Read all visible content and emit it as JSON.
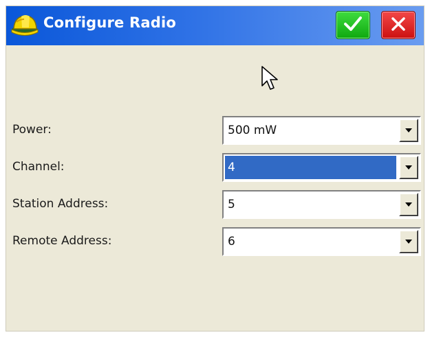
{
  "window": {
    "title": "Configure Radio",
    "ok_icon": "checkmark-icon",
    "close_icon": "close-icon",
    "accent": "#0a57d9",
    "ok_color": "#1fbf1f",
    "close_color": "#e02020"
  },
  "fields": [
    {
      "label": "Power:",
      "value": "500 mW"
    },
    {
      "label": "Channel:",
      "value": "4"
    },
    {
      "label": "Station Address:",
      "value": "5"
    },
    {
      "label": "Remote Address:",
      "value": "6"
    }
  ]
}
